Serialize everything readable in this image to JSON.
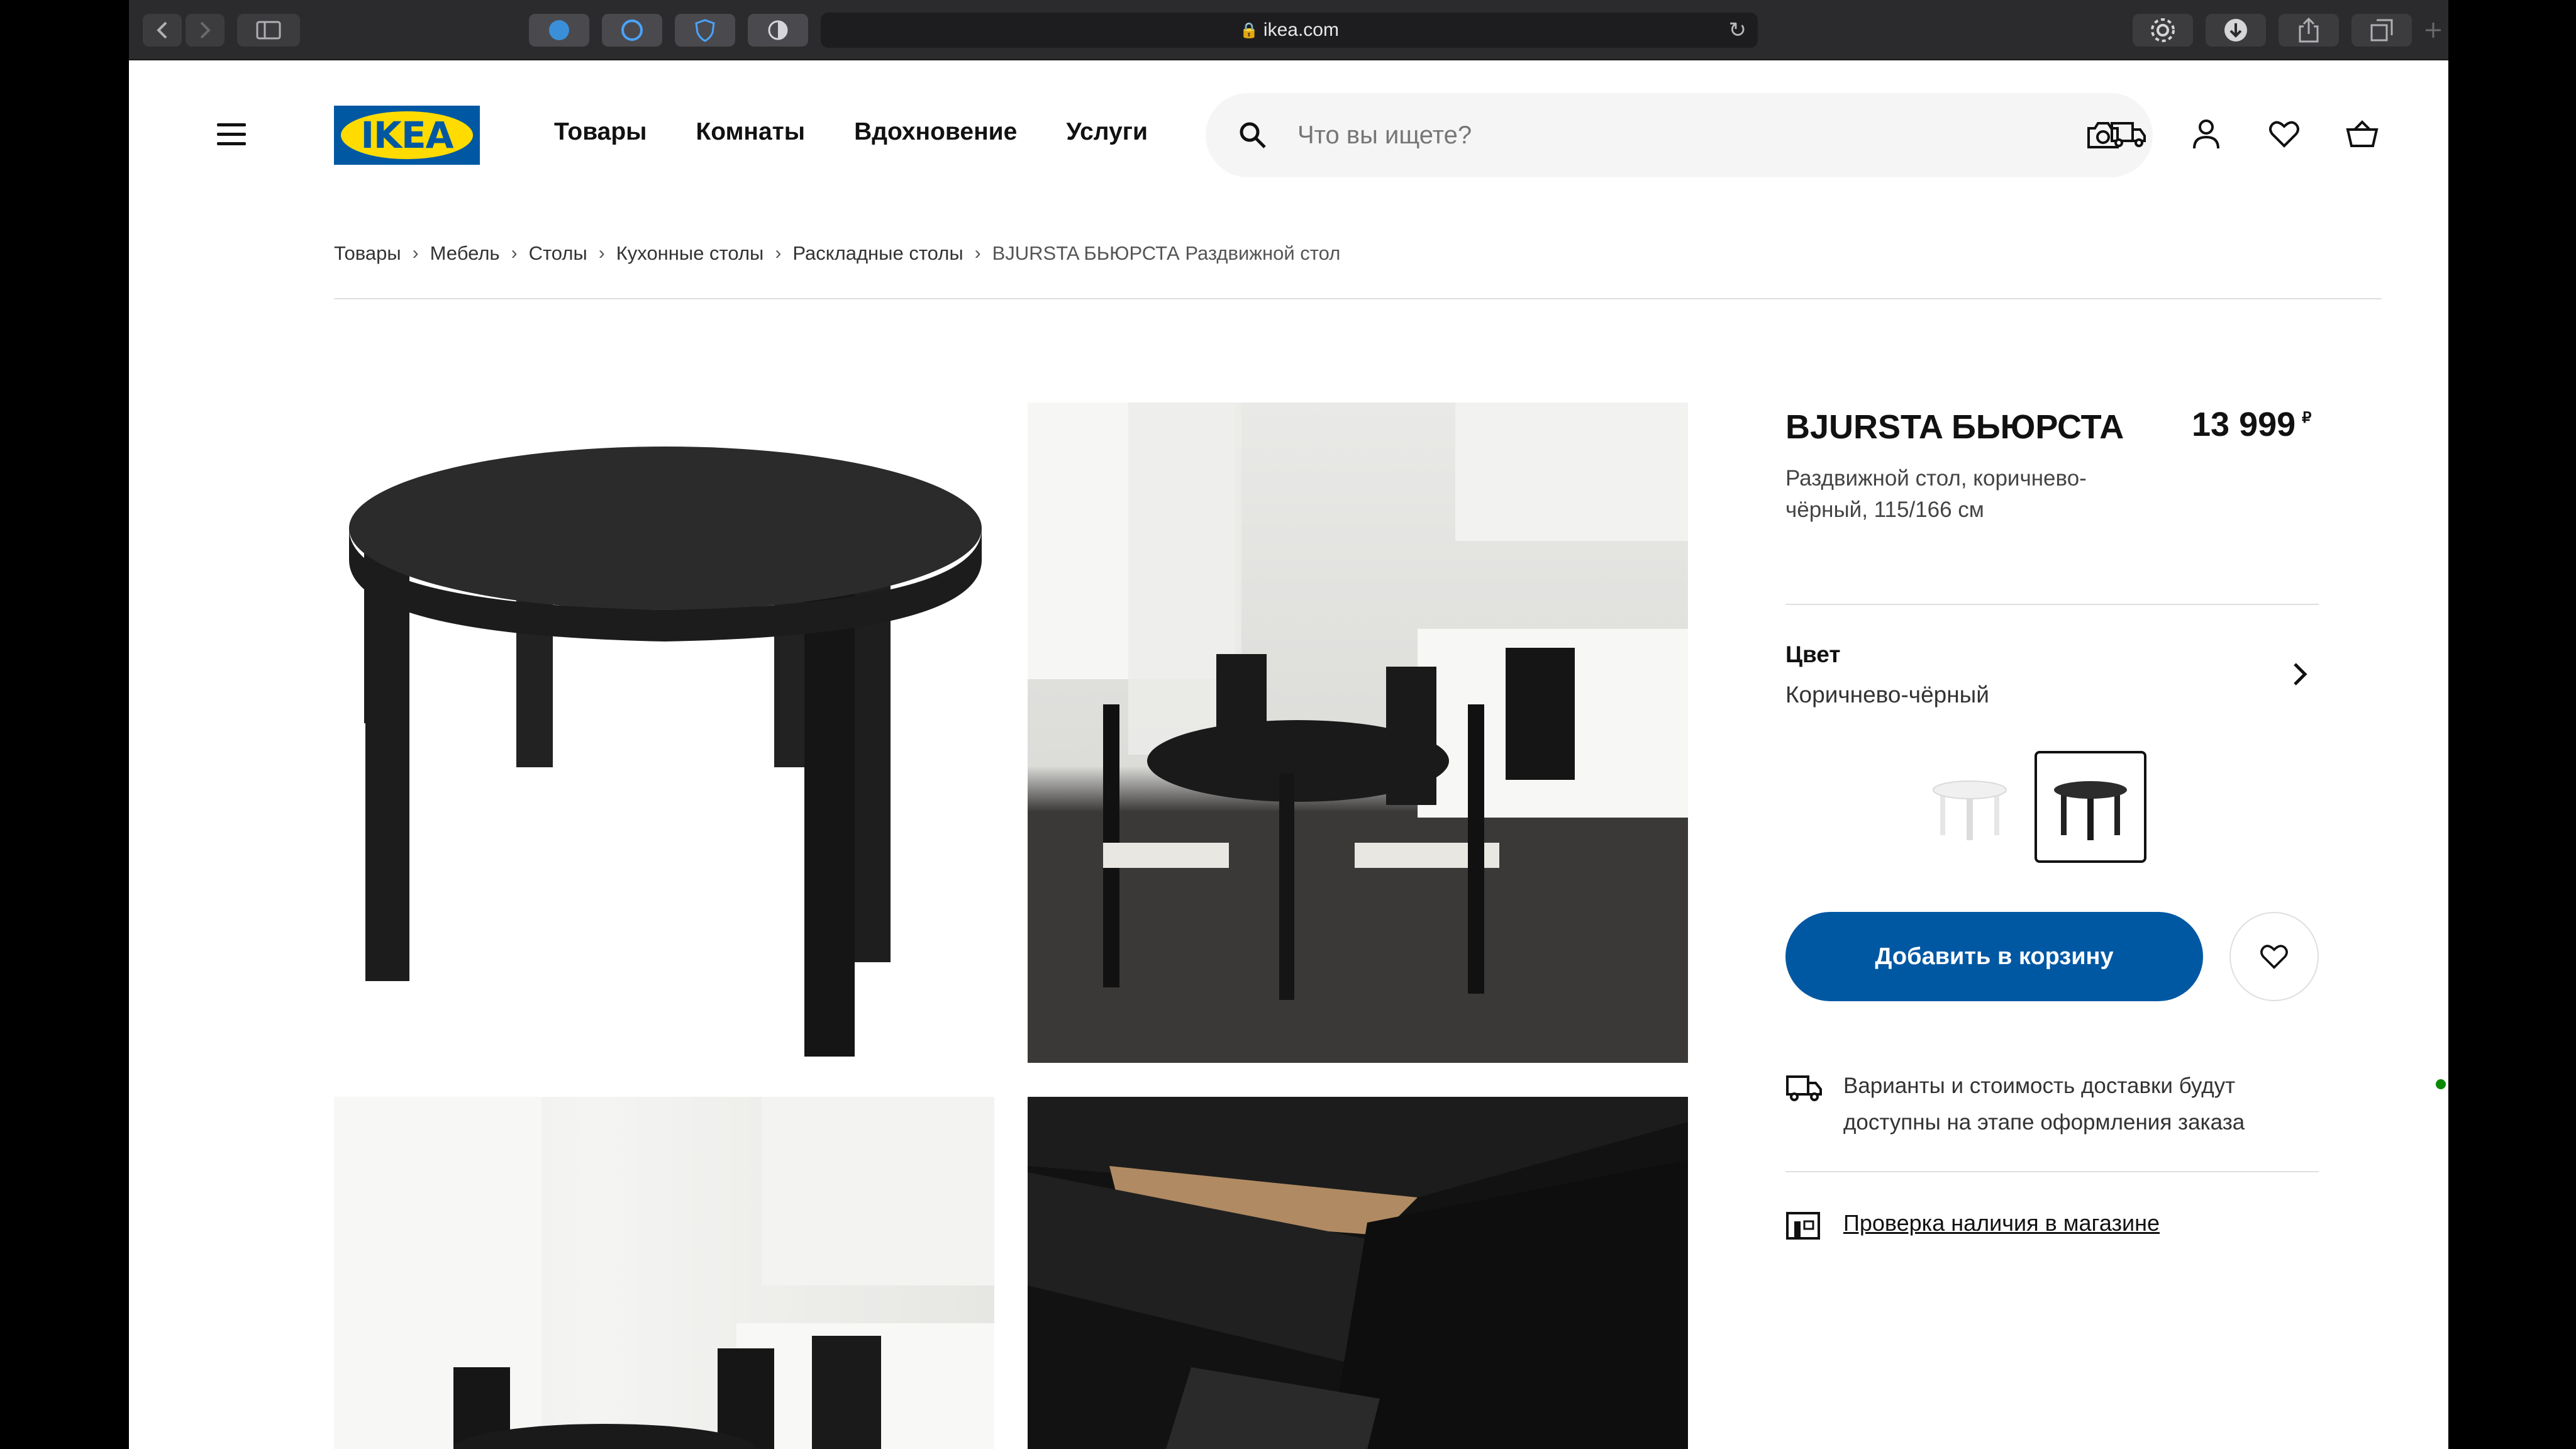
{
  "browser": {
    "url": "ikea.com",
    "icons": [
      "back-icon",
      "forward-icon",
      "sidebar-icon",
      "extension-icon",
      "share-icon",
      "tabs-icon",
      "new-tab-icon",
      "reload-icon",
      "download-icon",
      "settings-icon"
    ]
  },
  "header": {
    "logo_text": "IKEA",
    "nav": [
      "Товары",
      "Комнаты",
      "Вдохновение",
      "Услуги"
    ],
    "search_placeholder": "Что вы ищете?"
  },
  "breadcrumb": [
    "Товары",
    "Мебель",
    "Столы",
    "Кухонные столы",
    "Раскладные столы",
    "BJURSTA БЬЮРСТА Раздвижной стол"
  ],
  "product": {
    "name": "BJURSTA БЬЮРСТА",
    "price": "13 999",
    "currency": "₽",
    "description": "Раздвижной стол, коричнево-чёрный, 115/166 см",
    "color_label": "Цвет",
    "color_value": "Коричнево-чёрный",
    "add_to_cart": "Добавить в корзину",
    "delivery_text": "Варианты и стоимость доставки будут доступны на этапе оформления заказа",
    "store_check": "Проверка наличия в магазине"
  },
  "colors": {
    "brand_blue": "#0058a3",
    "brand_yellow": "#ffdb00",
    "available_green": "#0a8a00"
  }
}
